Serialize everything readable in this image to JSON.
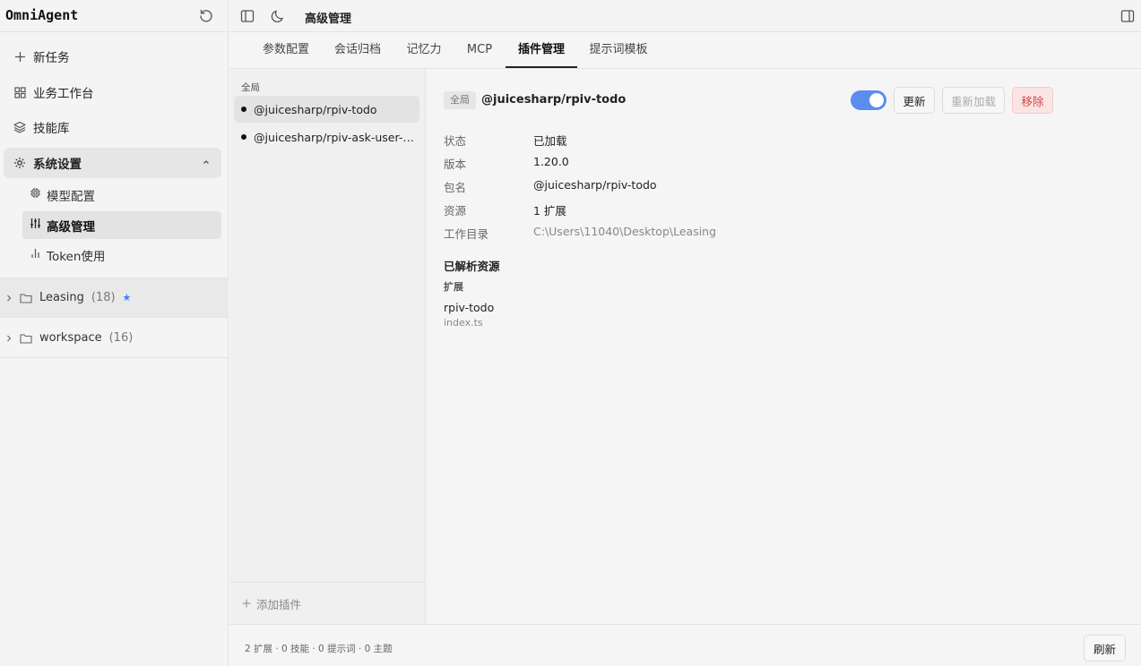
{
  "app": {
    "name": "OmniAgent"
  },
  "sidebar": {
    "items": [
      {
        "label": "新任务",
        "icon": "plus-icon"
      },
      {
        "label": "业务工作台",
        "icon": "grid-icon"
      },
      {
        "label": "技能库",
        "icon": "layers-icon"
      },
      {
        "label": "系统设置",
        "icon": "gear-icon"
      }
    ],
    "sub_items": [
      {
        "label": "模型配置",
        "icon": "chip-icon"
      },
      {
        "label": "高级管理",
        "icon": "sliders-icon"
      },
      {
        "label": "Token使用",
        "icon": "bar-chart-icon"
      }
    ],
    "projects": [
      {
        "name": "Leasing",
        "count": "(18)",
        "star": "★"
      },
      {
        "name": "workspace",
        "count": "(16)",
        "star": ""
      }
    ]
  },
  "header": {
    "title": "高级管理"
  },
  "tabs": [
    {
      "label": "参数配置"
    },
    {
      "label": "会话归档"
    },
    {
      "label": "记忆力"
    },
    {
      "label": "MCP"
    },
    {
      "label": "插件管理"
    },
    {
      "label": "提示词模板"
    }
  ],
  "plugin_list": {
    "group_label": "全局",
    "items": [
      {
        "label": "@juicesharp/rpiv-todo"
      },
      {
        "label": "@juicesharp/rpiv-ask-user-question"
      }
    ],
    "add_label": "添加插件"
  },
  "detail": {
    "scope": "全局",
    "package": "@juicesharp/rpiv-todo",
    "enabled": true,
    "buttons": {
      "update": "更新",
      "reload": "重新加载",
      "remove": "移除"
    },
    "fields": [
      {
        "key": "状态",
        "value": "已加载"
      },
      {
        "key": "版本",
        "value": "1.20.0"
      },
      {
        "key": "包名",
        "value": "@juicesharp/rpiv-todo"
      },
      {
        "key": "资源",
        "value": "1 扩展"
      },
      {
        "key": "工作目录",
        "value": "C:\\Users\\11040\\Desktop\\Leasing"
      }
    ],
    "resolved_title": "已解析资源",
    "resolved_group": "扩展",
    "resource_name": "rpiv-todo",
    "resource_file": "index.ts"
  },
  "footer": {
    "stats": "2 扩展 · 0 技能 · 0 提示词 · 0 主题",
    "refresh_label": "刷新"
  },
  "colors": {
    "accent": "#5b8def",
    "danger": "#d64545",
    "star": "#3b82f6"
  }
}
